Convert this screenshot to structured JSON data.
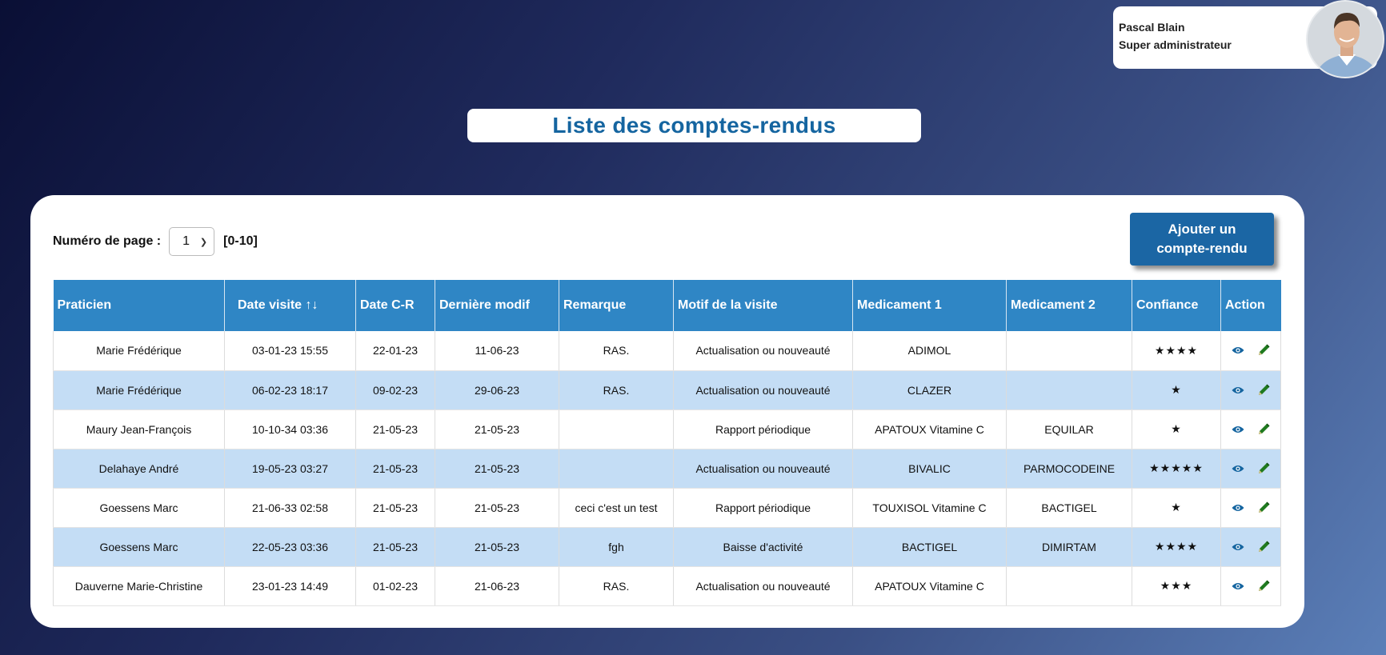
{
  "user": {
    "name": "Pascal Blain",
    "role": "Super administrateur"
  },
  "page_title": "Liste des comptes-rendus",
  "pager": {
    "label": "Numéro de page :",
    "selected": "1",
    "range": "[0-10]"
  },
  "add_button": {
    "line1": "Ajouter un",
    "line2": "compte-rendu"
  },
  "table": {
    "headers": [
      "Praticien",
      "Date visite ↑↓",
      "Date C-R",
      "Dernière modif",
      "Remarque",
      "Motif de la visite",
      "Medicament 1",
      "Medicament 2",
      "Confiance",
      "Action"
    ],
    "rows": [
      [
        "Marie Frédérique",
        "03-01-23 15:55",
        "22-01-23",
        "11-06-23",
        "RAS.",
        "Actualisation ou nouveauté",
        "ADIMOL",
        "",
        "★★★★"
      ],
      [
        "Marie Frédérique",
        "06-02-23 18:17",
        "09-02-23",
        "29-06-23",
        "RAS.",
        "Actualisation ou nouveauté",
        "CLAZER",
        "",
        "★"
      ],
      [
        "Maury Jean-François",
        "10-10-34 03:36",
        "21-05-23",
        "21-05-23",
        "",
        "Rapport périodique",
        "APATOUX Vitamine C",
        "EQUILAR",
        "★"
      ],
      [
        "Delahaye André",
        "19-05-23 03:27",
        "21-05-23",
        "21-05-23",
        "",
        "Actualisation ou nouveauté",
        "BIVALIC",
        "PARMOCODEINE",
        "★★★★★"
      ],
      [
        "Goessens Marc",
        "21-06-33 02:58",
        "21-05-23",
        "21-05-23",
        "ceci c'est un test",
        "Rapport périodique",
        "TOUXISOL Vitamine C",
        "BACTIGEL",
        "★"
      ],
      [
        "Goessens Marc",
        "22-05-23 03:36",
        "21-05-23",
        "21-05-23",
        "fgh",
        "Baisse d'activité",
        "BACTIGEL",
        "DIMIRTAM",
        "★★★★"
      ],
      [
        "Dauverne Marie-Christine",
        "23-01-23 14:49",
        "01-02-23",
        "21-06-23",
        "RAS.",
        "Actualisation ou nouveauté",
        "APATOUX Vitamine C",
        "",
        "★★★"
      ]
    ]
  },
  "colors": {
    "header_bg": "#2f86c5",
    "alt_row_bg": "#c4ddf5",
    "title_color": "#1565a0",
    "button_bg": "#1b66a4",
    "view_icon": "#1565a0",
    "edit_icon": "#1f7a1f"
  },
  "icons": {
    "view": "eye-icon",
    "edit": "pencil-icon"
  }
}
